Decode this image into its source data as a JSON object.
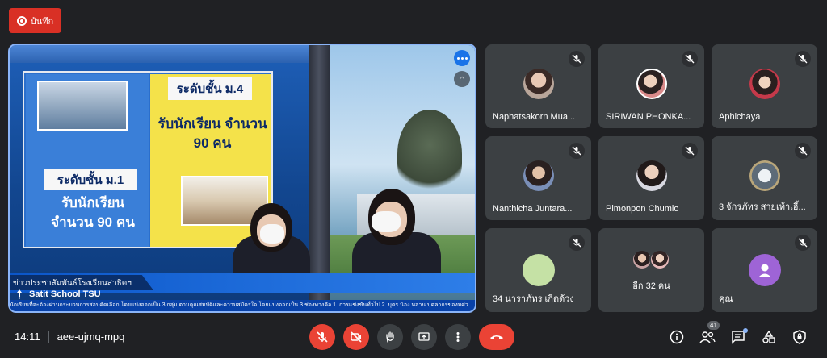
{
  "record": {
    "label": "บันทึก"
  },
  "main": {
    "poster": {
      "level1": "ระดับชั้น ม.1",
      "level1_text": "รับนักเรียน จำนวน 90 คน",
      "level4": "ระดับชั้น ม.4",
      "level4_text": "รับนักเรียน จำนวน 90 คน"
    },
    "lower_third": "ข่าวประชาสัมพันธ์โรงเรียนสาธิตฯ",
    "school": "Satit School TSU",
    "ticker": "นักเรียนที่จะต้องผ่านกระบวนการสอบคัดเลือก โดยแบ่งออกเป็น 3 กลุ่ม ตามคุณสมบัติและความสมัครใจ โดยแบ่งออกเป็น 3 ช่องทางคือ 1. การแข่งขันทั่วไป 2. บุตร น้อง หลาน บุคลากรของมศว"
  },
  "participants": [
    {
      "name": "Naphatsakorn Mua...",
      "avatar": "photo"
    },
    {
      "name": "SIRIWAN PHONKA...",
      "avatar": "photo2"
    },
    {
      "name": "Aphichaya",
      "avatar": "photo3"
    },
    {
      "name": "Nanthicha Juntara...",
      "avatar": "photo4"
    },
    {
      "name": "Pimonpon Chumlo",
      "avatar": "photo5"
    },
    {
      "name": "3 จักรภัทร สายเท้าเอี้...",
      "avatar": "photo6"
    },
    {
      "name": "34 นาราภัทร เกิดด้วง",
      "avatar": "plain"
    },
    {
      "name": "",
      "avatar": "more"
    },
    {
      "name": "คุณ",
      "avatar": "you"
    }
  ],
  "more_label": "อีก 32 คน",
  "bottom": {
    "time": "14:11",
    "meeting_code": "aee-ujmq-mpq",
    "participant_count": "41"
  },
  "colors": {
    "end_call": "#ea4335",
    "accent": "#8ab4f8",
    "you_avatar": "#9e64d6"
  }
}
